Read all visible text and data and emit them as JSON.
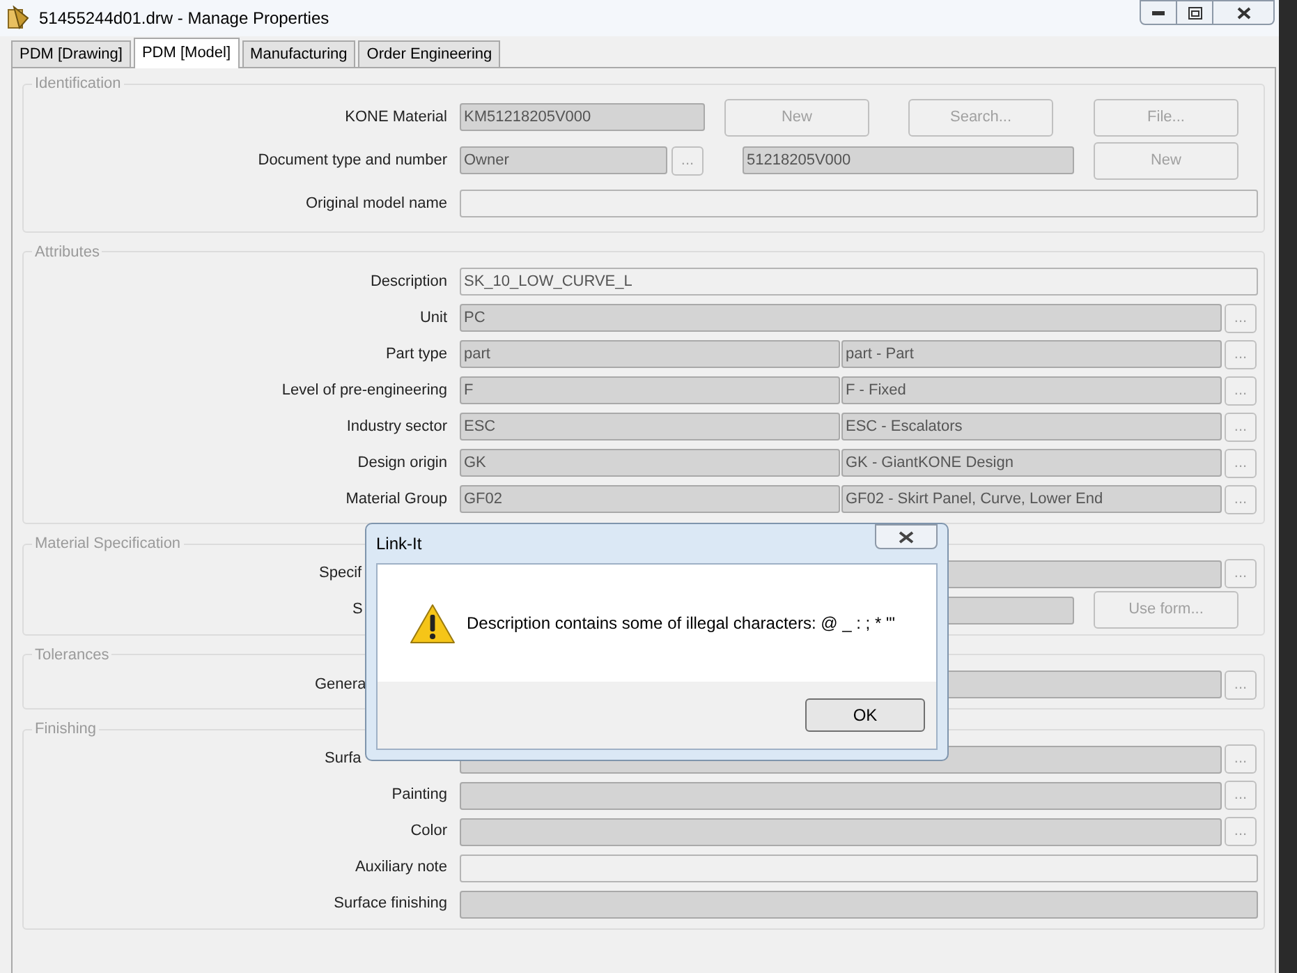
{
  "window": {
    "title": "51455244d01.drw - Manage Properties"
  },
  "tabs": [
    {
      "label": "PDM [Drawing]",
      "selected": false
    },
    {
      "label": "PDM [Model]",
      "selected": true
    },
    {
      "label": "Manufacturing",
      "selected": false
    },
    {
      "label": "Order Engineering",
      "selected": false
    }
  ],
  "sections": [
    {
      "title": "Identification",
      "rows": [
        {
          "kind": "field_buttons",
          "label": "KONE Material",
          "fields": [
            {
              "value": "KM51218205V000",
              "disabled": true
            }
          ],
          "buttons": [
            {
              "label": "New",
              "disabled": true
            },
            {
              "label": "Search...",
              "disabled": true
            },
            {
              "label": "File...",
              "disabled": true
            }
          ]
        },
        {
          "kind": "doc_number",
          "label": "Document type and number",
          "fields": [
            {
              "value": "Owner",
              "disabled": true
            },
            {
              "value": "51218205V000",
              "disabled": true
            }
          ],
          "buttons": [
            {
              "label": "...",
              "disabled": true
            },
            {
              "label": "New",
              "disabled": true
            }
          ]
        },
        {
          "kind": "full",
          "label": "Original model name",
          "fields": [
            {
              "disabled": false
            }
          ]
        }
      ]
    },
    {
      "title": "Attributes",
      "rows": [
        {
          "kind": "full",
          "label": "Description",
          "fields": [
            {
              "value": "SK_10_LOW_CURVE_L",
              "disabled": false
            }
          ]
        },
        {
          "kind": "picker",
          "label": "Unit",
          "fields": [
            {
              "value": "PC",
              "disabled": true
            }
          ],
          "buttons": [
            {
              "label": "...",
              "disabled": true
            }
          ]
        },
        {
          "kind": "pair_picker",
          "label": "Part type",
          "fields": [
            {
              "value": "part",
              "disabled": true
            },
            {
              "value": "part - Part",
              "disabled": true
            }
          ],
          "buttons": [
            {
              "label": "...",
              "disabled": true
            }
          ]
        },
        {
          "kind": "pair_picker",
          "label": "Level of pre-engineering",
          "fields": [
            {
              "value": "F",
              "disabled": true
            },
            {
              "value": "F - Fixed",
              "disabled": true
            }
          ],
          "buttons": [
            {
              "label": "...",
              "disabled": true
            }
          ]
        },
        {
          "kind": "pair_picker",
          "label": "Industry sector",
          "fields": [
            {
              "value": "ESC",
              "disabled": true
            },
            {
              "value": "ESC - Escalators",
              "disabled": true
            }
          ],
          "buttons": [
            {
              "label": "...",
              "disabled": true
            }
          ]
        },
        {
          "kind": "pair_picker",
          "label": "Design origin",
          "fields": [
            {
              "value": "GK",
              "disabled": true
            },
            {
              "value": "GK - GiantKONE Design",
              "disabled": true
            }
          ],
          "buttons": [
            {
              "label": "...",
              "disabled": true
            }
          ]
        },
        {
          "kind": "pair_picker",
          "label": "Material Group",
          "fields": [
            {
              "value": "GF02",
              "disabled": true
            },
            {
              "value": "GF02 - Skirt Panel, Curve, Lower End",
              "disabled": true
            }
          ],
          "buttons": [
            {
              "label": "...",
              "disabled": true
            }
          ]
        }
      ]
    },
    {
      "title": "Material Specification",
      "rows": [
        {
          "kind": "picker",
          "label": "Specif",
          "cut": true,
          "fields": [
            {
              "disabled": true
            }
          ],
          "buttons": [
            {
              "label": "...",
              "disabled": true
            }
          ]
        },
        {
          "kind": "field_button",
          "label": "S",
          "cut": true,
          "fields": [
            {
              "disabled": true
            }
          ],
          "buttons": [
            {
              "label": "Use form...",
              "disabled": true
            }
          ]
        }
      ]
    },
    {
      "title": "Tolerances",
      "rows": [
        {
          "kind": "picker",
          "label": "Genera",
          "cut": true,
          "fields": [
            {
              "disabled": true
            }
          ],
          "buttons": [
            {
              "label": "...",
              "disabled": true
            }
          ]
        }
      ]
    },
    {
      "title": "Finishing",
      "rows": [
        {
          "kind": "picker",
          "label": "Surfa",
          "cut": true,
          "fields": [
            {
              "disabled": true
            }
          ],
          "buttons": [
            {
              "label": "...",
              "disabled": true
            }
          ]
        },
        {
          "kind": "picker",
          "label": "Painting",
          "fields": [
            {
              "disabled": true
            }
          ],
          "buttons": [
            {
              "label": "...",
              "disabled": true
            }
          ]
        },
        {
          "kind": "picker",
          "label": "Color",
          "fields": [
            {
              "disabled": true
            }
          ],
          "buttons": [
            {
              "label": "...",
              "disabled": true
            }
          ]
        },
        {
          "kind": "full",
          "label": "Auxiliary note",
          "fields": [
            {
              "disabled": false
            }
          ]
        },
        {
          "kind": "full",
          "label": "Surface finishing",
          "fields": [
            {
              "disabled": true
            }
          ]
        }
      ]
    }
  ],
  "dialog": {
    "title": "Link-It",
    "message": "Description contains some of illegal characters: @ _ : ; * \"'",
    "buttons": [
      {
        "label": "OK"
      }
    ]
  }
}
